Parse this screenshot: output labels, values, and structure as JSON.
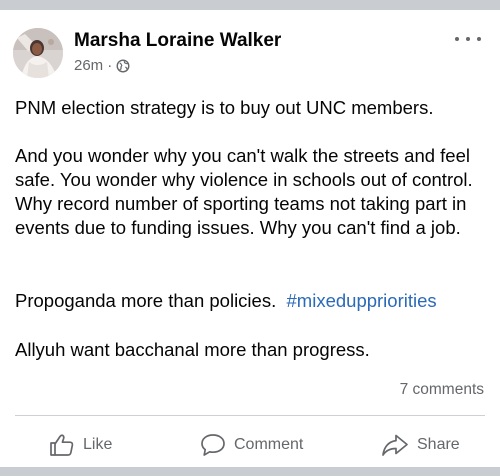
{
  "post": {
    "author": "Marsha Loraine Walker",
    "time": "26m",
    "separator": "·",
    "audience_icon": "globe-icon",
    "paragraphs": {
      "p1": "PNM election strategy is to buy out UNC members.",
      "p2": "And you wonder why you can't walk the streets and feel safe.  You wonder why violence in schools out of control.  Why record number of sporting teams not taking part in events due to funding issues.  Why you can't find a job.",
      "p3_text": "Propoganda more than policies.  ",
      "p3_hashtag": "#mixeduppriorities",
      "p4": "Allyuh want bacchanal more than progress."
    },
    "comments_count": "7 comments"
  },
  "actions": {
    "like": "Like",
    "comment": "Comment",
    "share": "Share"
  },
  "colors": {
    "secondary_text": "#65676b",
    "hashtag": "#2a6ab8",
    "divider": "#c9ccd1"
  }
}
